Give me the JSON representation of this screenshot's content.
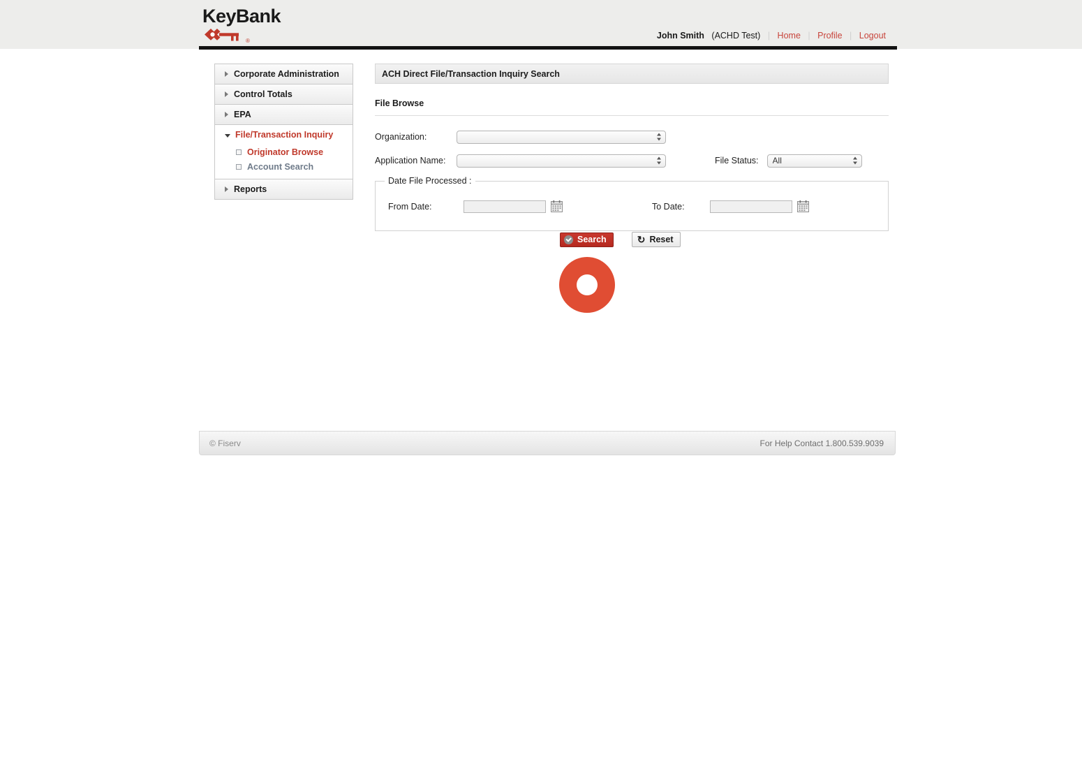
{
  "brand": {
    "name": "KeyBank",
    "registered_mark": "®",
    "key_icon": "key-icon",
    "accent_red": "#c0392b",
    "link_red": "#c8453c"
  },
  "header": {
    "user_name": "John Smith",
    "user_org": "(ACHD Test)",
    "links": [
      {
        "label": "Home",
        "name": "home-link"
      },
      {
        "label": "Profile",
        "name": "profile-link"
      },
      {
        "label": "Logout",
        "name": "logout-link"
      }
    ],
    "separator": "|"
  },
  "sidebar": {
    "groups": [
      {
        "label": "Corporate Administration",
        "expanded": false,
        "icon": "chevron-right-icon"
      },
      {
        "label": "Control Totals",
        "expanded": false,
        "icon": "chevron-right-icon"
      },
      {
        "label": "EPA",
        "expanded": false,
        "icon": "chevron-right-icon"
      },
      {
        "label": "File/Transaction Inquiry",
        "expanded": true,
        "icon": "chevron-down-icon",
        "items": [
          {
            "label": "Originator Browse",
            "selected": true,
            "bullet": "square-bullet-icon"
          },
          {
            "label": "Account Search",
            "selected": false,
            "bullet": "square-bullet-icon"
          }
        ]
      },
      {
        "label": "Reports",
        "expanded": false,
        "icon": "chevron-right-icon"
      }
    ]
  },
  "main": {
    "page_title": "ACH Direct File/Transaction Inquiry Search",
    "section_title": "File Browse",
    "fields": {
      "organization_label": "Organization:",
      "organization_value": "",
      "application_label": "Application Name:",
      "application_value": "",
      "file_status_label": "File Status:",
      "file_status_value": "All"
    },
    "date_fieldset": {
      "legend": "Date File Processed :",
      "from_label": "From Date:",
      "from_value": "",
      "to_label": "To Date:",
      "to_value": "",
      "calendar_icon": "calendar-icon"
    },
    "buttons": {
      "search_label": "Search",
      "search_icon": "check-circle-icon",
      "reset_label": "Reset",
      "reset_icon": "refresh-icon"
    },
    "loading": {
      "name": "loading-spinner",
      "color": "#e04d33"
    }
  },
  "footer": {
    "copyright": "© Fiserv",
    "help": "For Help Contact 1.800.539.9039"
  }
}
